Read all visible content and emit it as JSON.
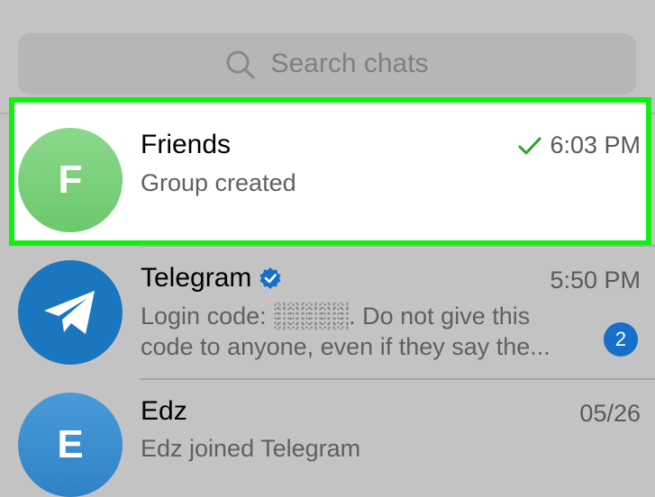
{
  "search": {
    "placeholder": "Search chats",
    "icon": "search-icon"
  },
  "colors": {
    "highlight_border": "#11f011",
    "friends_avatar": "#7ed37e",
    "telegram_avatar": "#1b76c0",
    "edz_avatar": "#3b8ecf",
    "badge": "#166fc9",
    "check": "#2ea12e",
    "verified": "#166fc9"
  },
  "chats": [
    {
      "name": "Friends",
      "avatar_letter": "F",
      "time": "6:03 PM",
      "preview": "Group created",
      "status_icon": "check-icon"
    },
    {
      "name": "Telegram",
      "avatar_icon": "paper-plane-icon",
      "verified_icon": "verified-badge-icon",
      "time": "5:50 PM",
      "preview_prefix": "Login code: ",
      "preview_suffix": ". Do not give this",
      "preview_line2": "code to anyone, even if they say the...",
      "unread": "2"
    },
    {
      "name": "Edz",
      "avatar_letter": "E",
      "time": "05/26",
      "preview": "Edz joined Telegram"
    }
  ]
}
